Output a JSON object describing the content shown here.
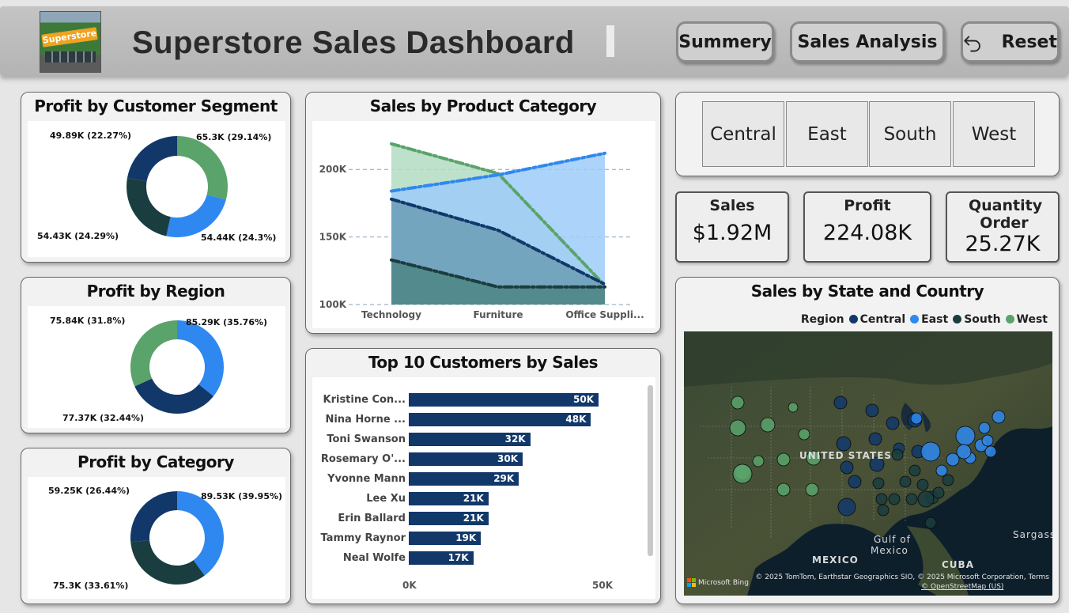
{
  "header": {
    "title": "Superstore Sales Dashboard",
    "logo_text": "Superstore",
    "buttons": {
      "summary": "Summery",
      "sales_analysis": "Sales Analysis",
      "reset": "Reset"
    }
  },
  "segment_card": {
    "title": "Profit by Customer Segment",
    "slices": [
      {
        "label": "65.3K (29.14%)",
        "value": 65.3,
        "color": "#5aa36b"
      },
      {
        "label": "54.44K (24.3%)",
        "value": 54.44,
        "color": "#2f88f0"
      },
      {
        "label": "54.43K (24.29%)",
        "value": 54.43,
        "color": "#1a3d3f"
      },
      {
        "label": "49.89K (22.27%)",
        "value": 49.89,
        "color": "#12386a"
      }
    ]
  },
  "region_card": {
    "title": "Profit by Region",
    "slices": [
      {
        "label": "85.29K (35.76%)",
        "value": 85.29,
        "color": "#2f88f0"
      },
      {
        "label": "77.37K (32.44%)",
        "value": 77.37,
        "color": "#12386a"
      },
      {
        "label": "75.84K (31.8%)",
        "value": 75.84,
        "color": "#5aa36b"
      }
    ]
  },
  "category_card": {
    "title": "Profit by Category",
    "slices": [
      {
        "label": "89.53K (39.95%)",
        "value": 89.53,
        "color": "#2f88f0"
      },
      {
        "label": "75.3K (33.61%)",
        "value": 75.3,
        "color": "#1a3d3f"
      },
      {
        "label": "59.25K (26.44%)",
        "value": 59.25,
        "color": "#12386a"
      }
    ]
  },
  "sales_category_card": {
    "title": "Sales by Product Category"
  },
  "chart_data": [
    {
      "type": "area",
      "title": "Sales by Product Category",
      "categories": [
        "Technology",
        "Furniture",
        "Office Suppli..."
      ],
      "ylim": [
        100000,
        230000
      ],
      "yticks": [
        "100K",
        "150K",
        "200K"
      ],
      "ytick_values": [
        100000,
        150000,
        200000
      ],
      "grid": true,
      "series": [
        {
          "values": [
            219000,
            197000,
            114000
          ],
          "color": "#5aa36b",
          "fill": "#b3dcc2"
        },
        {
          "values": [
            184000,
            196000,
            212000
          ],
          "color": "#2f88f0",
          "fill": "#9ecbf9"
        },
        {
          "values": [
            178000,
            155000,
            115000
          ],
          "color": "#12386a",
          "fill": "#6c9db6"
        },
        {
          "values": [
            133000,
            113000,
            113000
          ],
          "color": "#1a3d3f",
          "fill": "#4c8585"
        }
      ]
    },
    {
      "type": "bar",
      "title": "Top 10 Customers by Sales",
      "categories": [
        "Kristine Con...",
        "Nina Horne ...",
        "Toni Swanson",
        "Rosemary O'...",
        "Yvonne Mann",
        "Lee Xu",
        "Erin Ballard",
        "Tammy Raynor",
        "Neal Wolfe"
      ],
      "values": [
        50000,
        48000,
        32000,
        30000,
        29000,
        21000,
        21000,
        19000,
        17000
      ],
      "labels": [
        "50K",
        "48K",
        "32K",
        "30K",
        "29K",
        "21K",
        "21K",
        "19K",
        "17K"
      ],
      "xticks": [
        "0K",
        "50K"
      ],
      "xlim": [
        0,
        50000
      ]
    }
  ],
  "top_customers_card": {
    "title": "Top 10 Customers by Sales"
  },
  "region_slicer": {
    "items": [
      "Central",
      "East",
      "South",
      "West"
    ]
  },
  "kpis": [
    {
      "label": "Sales",
      "value": "$1.92M"
    },
    {
      "label": "Profit",
      "value": "224.08K"
    },
    {
      "label": "Quantity Order",
      "value": "25.27K"
    }
  ],
  "map_card": {
    "title": "Sales by State and Country",
    "legend_title": "Region",
    "legend": [
      {
        "name": "Central",
        "color": "#12386a"
      },
      {
        "name": "East",
        "color": "#2f88f0"
      },
      {
        "name": "South",
        "color": "#1a3d3f"
      },
      {
        "name": "West",
        "color": "#5aa36b"
      }
    ],
    "labels": {
      "country": "UNITED STATES",
      "mexico": "MEXICO",
      "gulf_line1": "Gulf of",
      "gulf_line2": "Mexico",
      "cuba": "CUBA",
      "sea": "Sargasso"
    },
    "attribution": "© 2025 TomTom, Earthstar Geographics SIO, © 2025 Microsoft Corporation, Terms",
    "attribution2": "© OpenStreetMap (US)",
    "bing": "Microsoft Bing"
  }
}
